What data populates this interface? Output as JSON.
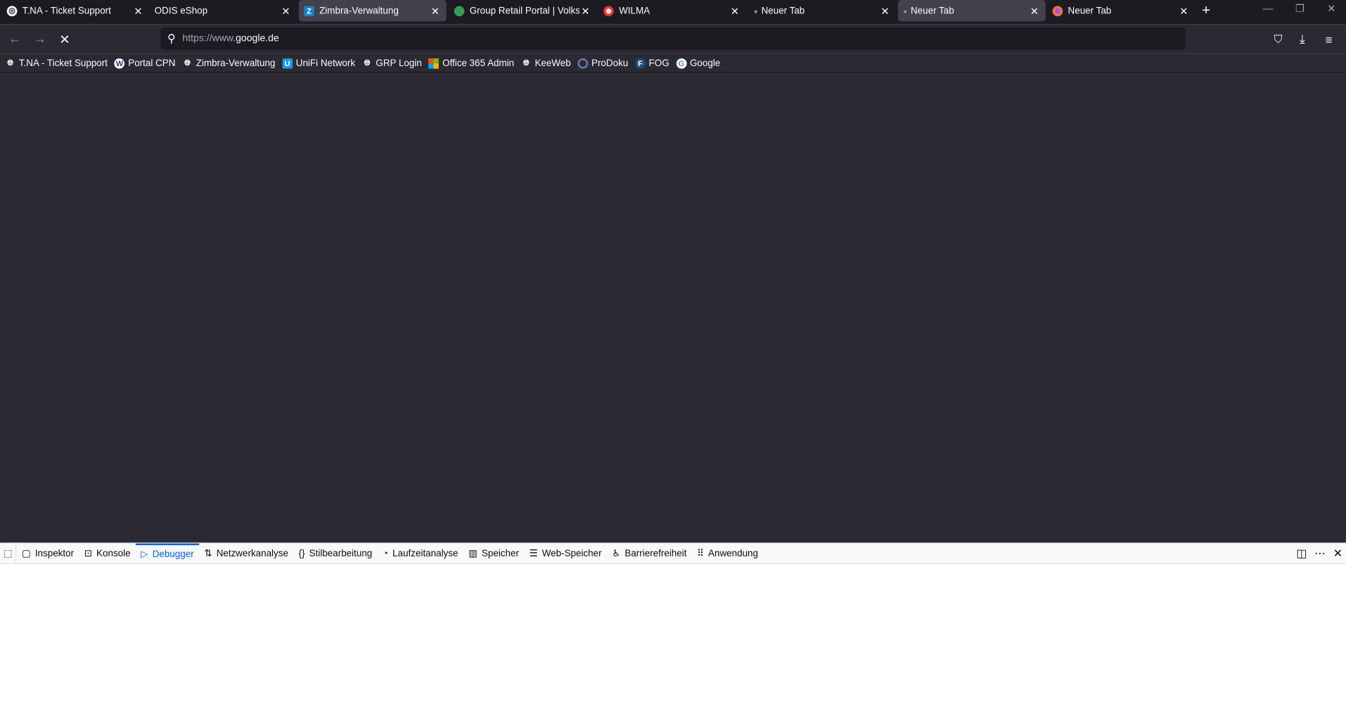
{
  "tabs": [
    {
      "title": "T.NA - Ticket Support",
      "icon": "lifebuoy-icon",
      "color": "#ffffff"
    },
    {
      "title": "ODIS eShop",
      "icon": "none"
    },
    {
      "title": "Zimbra-Verwaltung",
      "icon": "zimbra-icon",
      "color": "#1a82c4",
      "selected": true
    },
    {
      "title": "Group Retail Portal | Volkswagen",
      "icon": "globe-icon",
      "color": "#3a9a5a"
    },
    {
      "title": "WILMA",
      "icon": "lifebuoy-icon",
      "color": "#e33"
    },
    {
      "title": "Neuer Tab",
      "icon": "dot"
    },
    {
      "title": "Neuer Tab",
      "icon": "dot",
      "active": true
    },
    {
      "title": "Neuer Tab",
      "icon": "firefox-icon",
      "color": "#ff7139"
    }
  ],
  "url": {
    "prefix": "https://www.",
    "domain": "google.de"
  },
  "bookmarks": [
    {
      "label": "T.NA - Ticket Support",
      "icon": "globe-icon"
    },
    {
      "label": "Portal CPN",
      "icon": "vw-icon"
    },
    {
      "label": "Zimbra-Verwaltung",
      "icon": "globe-icon"
    },
    {
      "label": "UniFi Network",
      "icon": "unifi-icon"
    },
    {
      "label": "GRP Login",
      "icon": "globe-icon"
    },
    {
      "label": "Office 365 Admin",
      "icon": "microsoft-icon"
    },
    {
      "label": "KeeWeb",
      "icon": "globe-icon"
    },
    {
      "label": "ProDoku",
      "icon": "prodoku-icon"
    },
    {
      "label": "FOG",
      "icon": "fog-icon"
    },
    {
      "label": "Google",
      "icon": "google-icon"
    }
  ],
  "devtools": {
    "tabs": [
      "Inspektor",
      "Konsole",
      "Debugger",
      "Netzwerkanalyse",
      "Stilbearbeitung",
      "Laufzeitanalyse",
      "Speicher",
      "Web-Speicher",
      "Barrierefreiheit",
      "Anwendung"
    ],
    "selected": "Debugger"
  }
}
